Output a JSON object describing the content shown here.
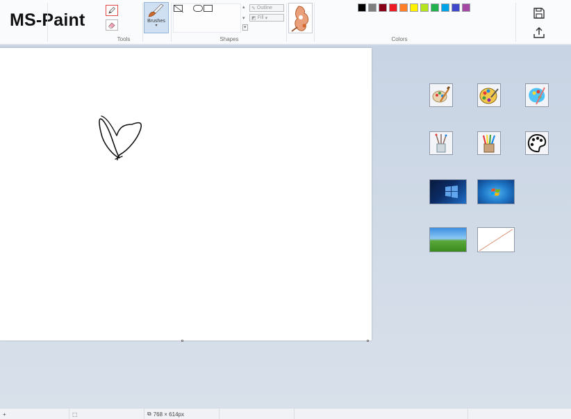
{
  "app": {
    "title": "MS-Paint"
  },
  "ribbon": {
    "groups": {
      "tools": "Tools",
      "shapes": "Shapes",
      "colors": "Colors"
    },
    "brushes_label": "Brushes",
    "outline_label": "Outline",
    "fill_label": "Fill"
  },
  "palette": [
    "#000000",
    "#7f7f7f",
    "#880015",
    "#ed1c24",
    "#ff7f27",
    "#fff200",
    "#b5e61d",
    "#22b14c",
    "#00a2e8",
    "#3f48cc",
    "#a349a4"
  ],
  "side_panel": {
    "icons": [
      "paint-brush-icon",
      "palette-icon",
      "paint-splash-icon",
      "brush-cup-icon",
      "crayon-cup-icon",
      "art-palette-icon"
    ],
    "wallpapers": [
      "windows-10-wallpaper",
      "windows-7-wallpaper",
      "windows-xp-bliss-wallpaper",
      "blank-canvas-thumbnail"
    ]
  },
  "statusbar": {
    "canvas_size": "768 × 614px"
  }
}
